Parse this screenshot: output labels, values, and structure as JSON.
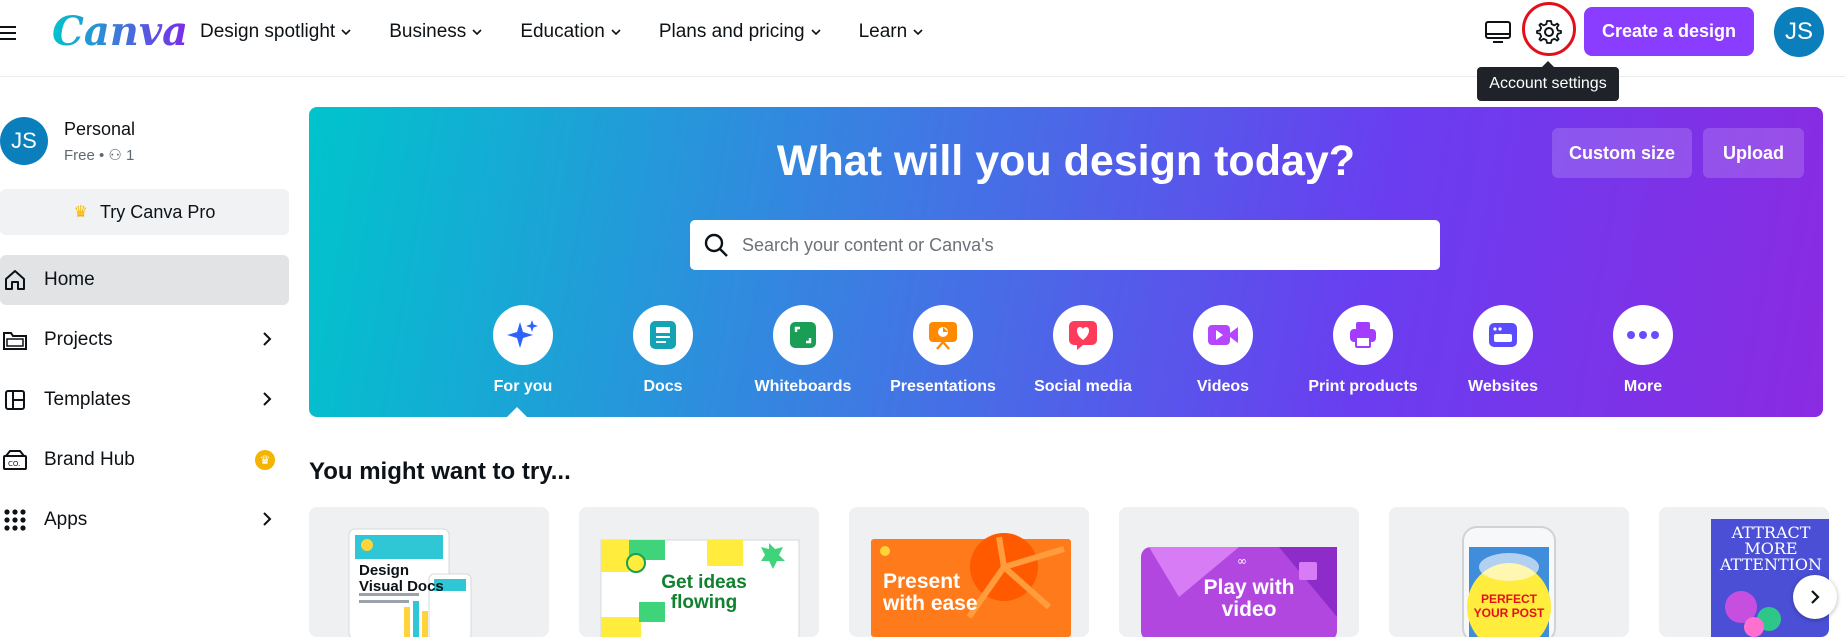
{
  "header": {
    "logo": "Canva",
    "nav": [
      {
        "label": "Design spotlight"
      },
      {
        "label": "Business"
      },
      {
        "label": "Education"
      },
      {
        "label": "Plans and pricing"
      },
      {
        "label": "Learn"
      }
    ],
    "create_button": "Create a design",
    "avatar_initials": "JS",
    "tooltip": "Account settings",
    "icons": [
      "menu-icon",
      "desktop-icon",
      "gear-icon"
    ]
  },
  "sidebar": {
    "profile": {
      "initials": "JS",
      "name": "Personal",
      "plan": "Free • ⚇ 1"
    },
    "try_pro": "Try Canva Pro",
    "items": [
      {
        "label": "Home",
        "icon": "home-icon",
        "active": true
      },
      {
        "label": "Projects",
        "icon": "folder-icon"
      },
      {
        "label": "Templates",
        "icon": "templates-icon"
      },
      {
        "label": "Brand Hub",
        "icon": "brand-icon"
      },
      {
        "label": "Apps",
        "icon": "apps-icon"
      }
    ]
  },
  "hero": {
    "title": "What will you design today?",
    "custom_size": "Custom size",
    "upload": "Upload",
    "search_placeholder": "Search your content or Canva's",
    "categories": [
      {
        "label": "For you",
        "color": "#2d62ff"
      },
      {
        "label": "Docs",
        "color": "#13a3b5"
      },
      {
        "label": "Whiteboards",
        "color": "#1a9e55"
      },
      {
        "label": "Presentations",
        "color": "#ff8a00"
      },
      {
        "label": "Social media",
        "color": "#ff3b5c"
      },
      {
        "label": "Videos",
        "color": "#b645ff"
      },
      {
        "label": "Print products",
        "color": "#a43cff"
      },
      {
        "label": "Websites",
        "color": "#5b4dff"
      },
      {
        "label": "More",
        "color": "#6b4bff"
      }
    ]
  },
  "suggestions": {
    "title": "You might want to try...",
    "cards": [
      {
        "label": "Design Visual Docs"
      },
      {
        "label": "Get ideas flowing"
      },
      {
        "label": "Present with ease"
      },
      {
        "label": "Play with video"
      },
      {
        "label": "PERFECT YOUR POST"
      },
      {
        "label": "ATTRACT MORE ATTENTION"
      }
    ]
  },
  "colors": {
    "brand_purple": "#8b3dff",
    "avatar_blue": "#0b7fbc",
    "highlight_ring": "#e3101a"
  }
}
